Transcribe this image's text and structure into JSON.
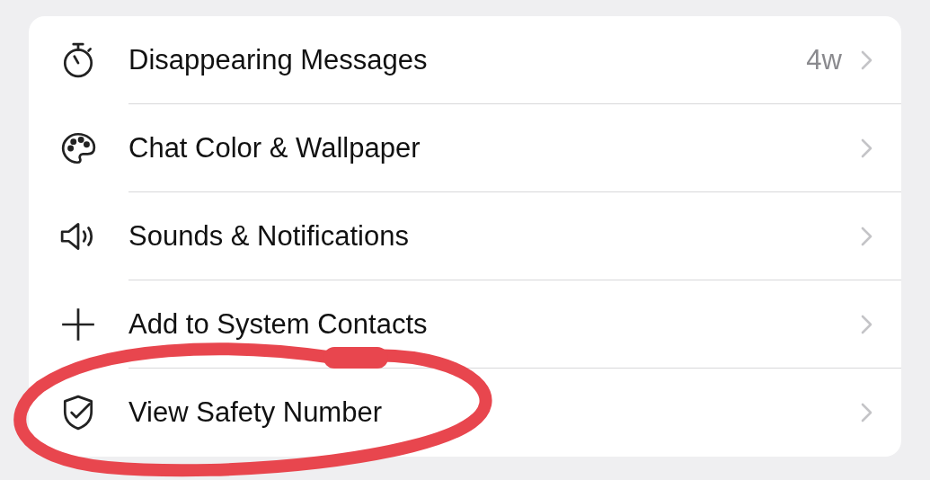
{
  "settings": [
    {
      "kind": "timer",
      "label": "Disappearing Messages",
      "value": "4w"
    },
    {
      "kind": "palette",
      "label": "Chat Color & Wallpaper"
    },
    {
      "kind": "speaker",
      "label": "Sounds & Notifications"
    },
    {
      "kind": "plus",
      "label": "Add to System Contacts"
    },
    {
      "kind": "shield",
      "label": "View Safety Number"
    }
  ]
}
